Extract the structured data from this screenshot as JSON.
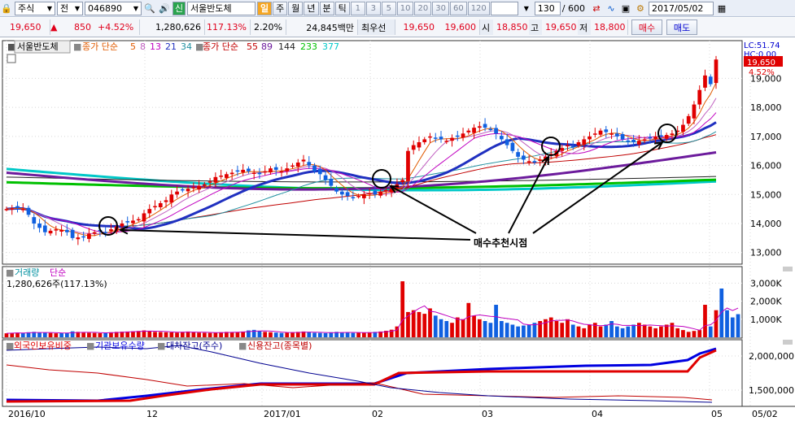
{
  "toolbar": {
    "market": "주식",
    "price_type": "전",
    "code": "046890",
    "sector_tag": "신",
    "stock_name": "서울반도체",
    "periods": [
      "일",
      "주",
      "월",
      "년",
      "분",
      "틱"
    ],
    "minute_options": [
      "1",
      "3",
      "5",
      "10",
      "20",
      "30",
      "60",
      "120"
    ],
    "count": "130",
    "count_total": "/ 600",
    "date": "2017/05/02",
    "icons": [
      "lock-icon",
      "search-icon",
      "speaker-icon",
      "chart-tool-icon",
      "chart-compare-icon",
      "save-icon",
      "settings-icon",
      "calendar-icon"
    ]
  },
  "info": {
    "price": "19,650",
    "change_arrow": "▲",
    "change": "850",
    "change_pct": "+4.52%",
    "volume": "1,280,626",
    "volume_ratio": "117.13%",
    "turnover": "2.20%",
    "amount": "24,845백만",
    "best_bid_label": "최우선",
    "best_bid": "19,650",
    "best_ask": "19,600",
    "open_label": "시",
    "open": "18,850",
    "high_label": "고",
    "high": "19,650",
    "low_label": "저",
    "low": "18,800",
    "buy_label": "매수",
    "sell_label": "매도"
  },
  "legend": {
    "name": "서울반도체",
    "price_label": "종가 단순",
    "price_ma": [
      "5",
      "8",
      "13",
      "21",
      "34"
    ],
    "price_ma_colors": [
      "#e05a00",
      "#c060c0",
      "#c000c0",
      "#2030c0",
      "#2090a0"
    ],
    "long_label": "종가 단순",
    "long_ma": [
      "55",
      "89",
      "144",
      "233",
      "377"
    ],
    "long_ma_colors": [
      "#c00000",
      "#6c1b9c",
      "#202020",
      "#00c000",
      "#00c8c8"
    ],
    "lc": "LC:51.74",
    "hc": "HC:0.00",
    "last_price": "19,650",
    "last_pct": "4.52%",
    "volume_title": "거래량",
    "volume_ma": "단순",
    "volume_value": "1,280,626주(117.13%)",
    "ind_series": [
      "외국인보유비중",
      "기관보유수량",
      "대차잔고(주수)",
      "신용잔고(종목별)"
    ],
    "ind_colors": [
      "#e00000",
      "#0000e0",
      "#000090",
      "#c00000"
    ],
    "annotation": "매수추천시점"
  },
  "chart_data": {
    "type": "candlestick",
    "price_axis": [
      "19,000",
      "18,000",
      "17,000",
      "16,000",
      "15,000",
      "14,000",
      "13,000"
    ],
    "price_ylim": [
      12600,
      20300
    ],
    "volume_axis": [
      "3,000K",
      "2,000K",
      "1,000K"
    ],
    "volume_ylim": [
      0,
      3600
    ],
    "ind_axis": [
      "2,000,000",
      "1,500,000"
    ],
    "x_ticks": [
      "2016/10",
      "12",
      "2017/01",
      "02",
      "03",
      "04",
      "05",
      "05/02"
    ],
    "closes": [
      14500,
      14520,
      14540,
      14500,
      14300,
      14000,
      13850,
      13700,
      13750,
      13800,
      13780,
      13700,
      13500,
      13520,
      13550,
      13650,
      13700,
      13750,
      13700,
      13800,
      13900,
      14000,
      14050,
      14100,
      14150,
      14350,
      14500,
      14600,
      14700,
      14800,
      15000,
      15100,
      15150,
      15200,
      15250,
      15300,
      15350,
      15450,
      15600,
      15650,
      15700,
      15750,
      15800,
      15850,
      15800,
      15750,
      15700,
      15800,
      15900,
      15850,
      15800,
      15900,
      16000,
      16100,
      16200,
      16000,
      15800,
      15700,
      15500,
      15300,
      15100,
      15000,
      14950,
      14900,
      14950,
      15000,
      15050,
      15000,
      15100,
      15150,
      15200,
      15350,
      15500,
      16500,
      16700,
      16800,
      16900,
      17000,
      16950,
      16900,
      16850,
      16950,
      17000,
      17100,
      17200,
      17300,
      17350,
      17300,
      17250,
      17100,
      16900,
      16700,
      16500,
      16300,
      16200,
      16150,
      16100,
      16200,
      16300,
      16400,
      16500,
      16600,
      16700,
      16650,
      16800,
      16900,
      17000,
      17100,
      17200,
      17150,
      17100,
      17000,
      16900,
      16850,
      16800,
      16850,
      16900,
      16950,
      17000,
      17000,
      17050,
      17100,
      17200,
      17400,
      17700,
      18100,
      18600,
      19100,
      18800,
      19650
    ],
    "volumes": [
      220,
      240,
      260,
      230,
      280,
      300,
      260,
      250,
      240,
      220,
      230,
      250,
      330,
      300,
      260,
      250,
      240,
      230,
      260,
      280,
      300,
      310,
      320,
      330,
      350,
      380,
      340,
      300,
      290,
      280,
      270,
      260,
      300,
      320,
      280,
      260,
      250,
      240,
      260,
      280,
      300,
      290,
      280,
      320,
      380,
      410,
      350,
      300,
      280,
      260,
      240,
      260,
      280,
      300,
      320,
      270,
      250,
      240,
      230,
      280,
      300,
      270,
      260,
      240,
      250,
      260,
      280,
      300,
      320,
      360,
      420,
      600,
      3100,
      1400,
      1500,
      1400,
      1300,
      1600,
      1200,
      1000,
      900,
      800,
      1100,
      1000,
      1900,
      1200,
      1000,
      900,
      800,
      1800,
      900,
      800,
      700,
      600,
      650,
      700,
      800,
      900,
      1000,
      1100,
      900,
      800,
      1000,
      700,
      600,
      500,
      700,
      800,
      600,
      700,
      900,
      600,
      500,
      600,
      700,
      800,
      700,
      600,
      500,
      600,
      700,
      800,
      500,
      400,
      300,
      350,
      400,
      1800,
      600,
      1500,
      2700,
      1500,
      1100,
      1280
    ]
  }
}
